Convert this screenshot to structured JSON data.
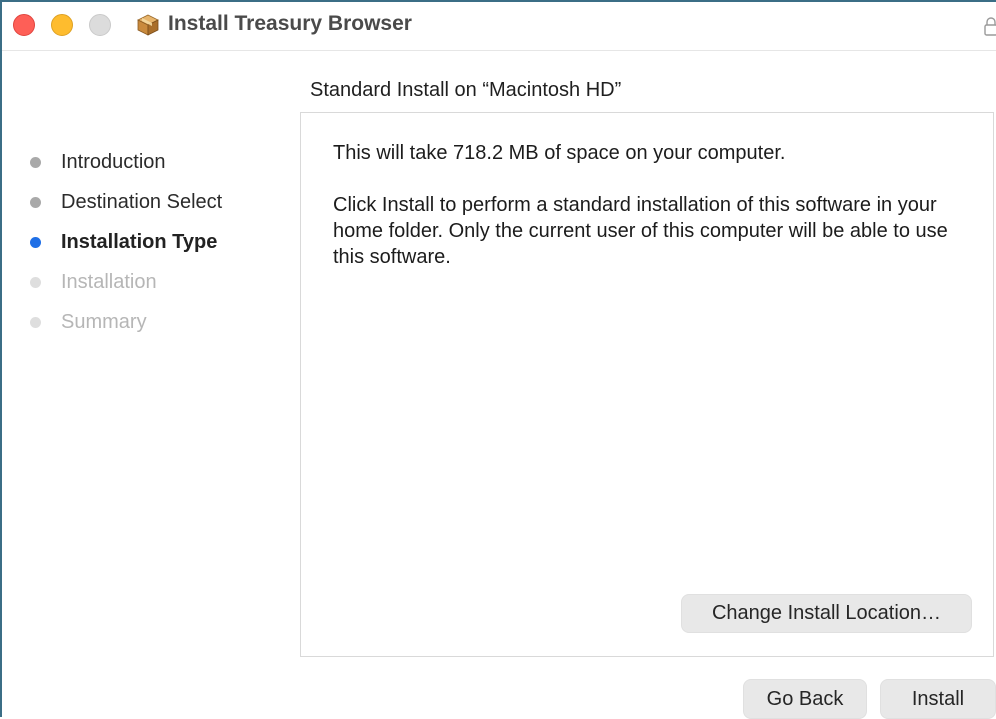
{
  "window": {
    "title": "Install Treasury Browser",
    "traffic_lights": {
      "close_color": "#fe5f57",
      "minimize_color": "#febc2e",
      "zoom_color": "#dcdcdc"
    },
    "app_icon": "package-box-icon",
    "lock_icon": "lock-icon"
  },
  "sidebar": {
    "steps": [
      {
        "label": "Introduction",
        "state": "done"
      },
      {
        "label": "Destination Select",
        "state": "done"
      },
      {
        "label": "Installation Type",
        "state": "current"
      },
      {
        "label": "Installation",
        "state": "pending"
      },
      {
        "label": "Summary",
        "state": "pending"
      }
    ],
    "current_dot_color": "#1f6fe6"
  },
  "main": {
    "heading": "Standard Install on “Macintosh HD”",
    "panel": {
      "space_text": "This will take 718.2 MB of space on your computer.",
      "description": "Click Install to perform a standard installation of this software in your home folder. Only the current user of this computer will be able to use this software.",
      "change_location_label": "Change Install Location…"
    }
  },
  "footer": {
    "go_back_label": "Go Back",
    "install_label": "Install"
  }
}
